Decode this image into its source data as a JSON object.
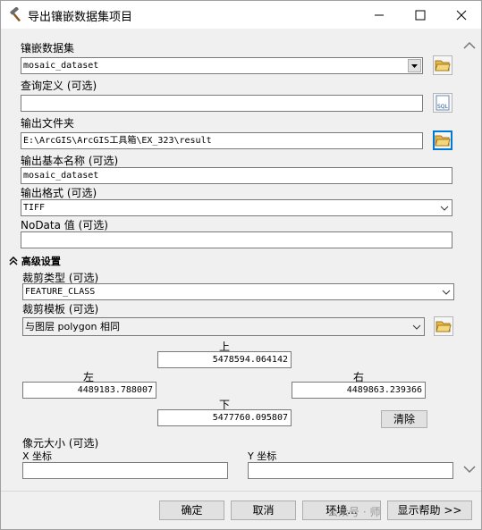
{
  "window": {
    "title": "导出镶嵌数据集项目"
  },
  "form": {
    "mosaic_dataset": {
      "label": "镶嵌数据集",
      "value": "mosaic_dataset"
    },
    "query_definition": {
      "label": "查询定义 (可选)",
      "value": ""
    },
    "output_folder": {
      "label": "输出文件夹",
      "value": "E:\\ArcGIS\\ArcGIS工具箱\\EX_323\\result"
    },
    "output_base_name": {
      "label": "输出基本名称 (可选)",
      "value": "mosaic_dataset"
    },
    "output_format": {
      "label": "输出格式 (可选)",
      "value": "TIFF"
    },
    "nodata": {
      "label": "NoData 值 (可选)",
      "value": ""
    },
    "advanced": {
      "header": "高级设置",
      "clip_type": {
        "label": "裁剪类型 (可选)",
        "value": "FEATURE_CLASS"
      },
      "clip_template": {
        "label": "裁剪模板 (可选)",
        "value": "与图层 polygon 相同"
      },
      "extent": {
        "top_label": "上",
        "top": "5478594.064142",
        "left_label": "左",
        "left": "4489183.788007",
        "right_label": "右",
        "right": "4489863.239366",
        "bottom_label": "下",
        "bottom": "5477760.095807",
        "clear_label": "清除"
      },
      "cell_size": {
        "label": "像元大小 (可选)",
        "x_label": "X 坐标",
        "x_value": "",
        "y_label": "Y 坐标",
        "y_value": ""
      }
    }
  },
  "buttons": {
    "ok": "确定",
    "cancel": "取消",
    "environments": "环境...",
    "show_help": "显示帮助 >>"
  },
  "watermark": "公众号 · 师"
}
